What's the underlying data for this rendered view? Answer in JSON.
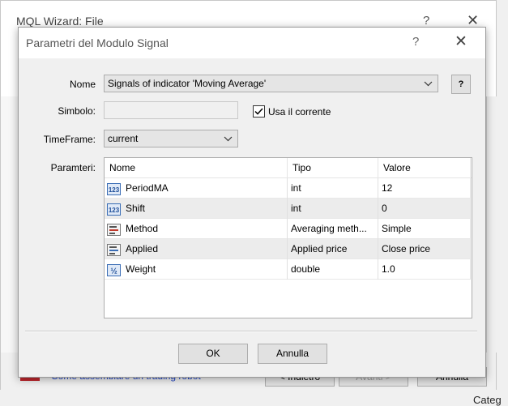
{
  "background_window": {
    "title": "MQL Wizard: File",
    "help": "?",
    "close": "✕",
    "link": "Come assemblare un trading robot",
    "back_button": "< Indietro",
    "next_button": "Avanti >",
    "cancel_button": "Annulla",
    "category_text": "Categ"
  },
  "dialog": {
    "title": "Parametri del Modulo Signal",
    "help": "?",
    "close": "✕",
    "name_label": "Nome",
    "name_value": "Signals of indicator 'Moving Average'",
    "name_help": "?",
    "symbol_label": "Simbolo:",
    "symbol_value": "",
    "use_current_label": "Usa il corrente",
    "use_current_checked": true,
    "timeframe_label": "TimeFrame:",
    "timeframe_value": "current",
    "params_label": "Paramteri:",
    "columns": [
      "Nome",
      "Tipo",
      "Valore"
    ],
    "rows": [
      {
        "icon": "numeric-icon",
        "name": "PeriodMA",
        "type": "int",
        "value": "12"
      },
      {
        "icon": "numeric-icon",
        "name": "Shift",
        "type": "int",
        "value": "0"
      },
      {
        "icon": "enum-list-icon",
        "name": "Method",
        "type": "Averaging meth...",
        "value": "Simple"
      },
      {
        "icon": "enum-list-icon",
        "name": "Applied",
        "type": "Applied price",
        "value": "Close price"
      },
      {
        "icon": "fraction-icon",
        "name": "Weight",
        "type": "double",
        "value": "1.0"
      }
    ],
    "ok_button": "OK",
    "cancel_button": "Annulla"
  },
  "colors": {
    "link": "#1a3fc4",
    "dialog_bg": "#f0f0f0",
    "row_alt": "#ececec"
  }
}
